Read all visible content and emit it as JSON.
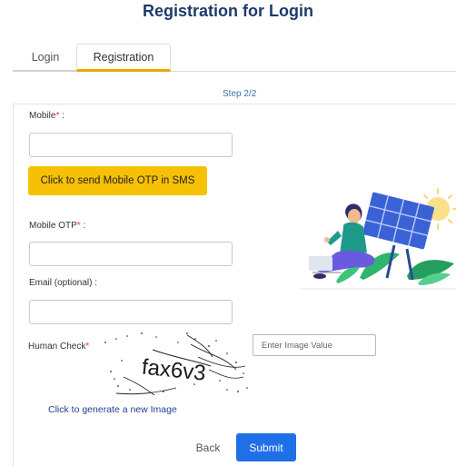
{
  "page": {
    "title": "Registration for Login"
  },
  "tabs": [
    {
      "label": "Login",
      "active": false
    },
    {
      "label": "Registration",
      "active": true
    }
  ],
  "step": "Step 2/2",
  "form": {
    "mobile_label": "Mobile",
    "mobile_value": "",
    "otp_button": "Click to send Mobile OTP in SMS",
    "mobile_otp_label": "Mobile OTP",
    "mobile_otp_value": "",
    "email_label": "Email (optional) :",
    "email_value": "",
    "human_check_label": "Human Check",
    "captcha_placeholder": "Enter Image Value",
    "captcha_text": "fax6v3",
    "new_image_link": "Click to generate a new Image",
    "required_mark": "*",
    "label_suffix": " :"
  },
  "actions": {
    "back": "Back",
    "submit": "Submit"
  },
  "colors": {
    "accent": "#f6c105",
    "primary": "#1f6fe6",
    "title": "#1e3a6b",
    "tab_underline": "#f0a500"
  },
  "icons": {
    "illustration": "solar-panel-illustration"
  }
}
